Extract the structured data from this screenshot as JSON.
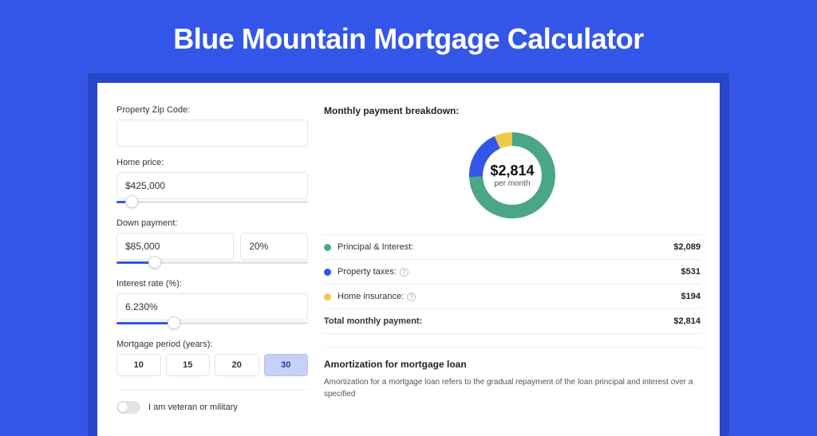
{
  "page": {
    "title": "Blue Mountain Mortgage Calculator"
  },
  "form": {
    "zip": {
      "label": "Property Zip Code:",
      "value": ""
    },
    "price": {
      "label": "Home price:",
      "value": "$425,000",
      "slider_pct": 8
    },
    "down": {
      "label": "Down payment:",
      "value": "$85,000",
      "pct": "20%",
      "slider_pct": 20
    },
    "rate": {
      "label": "Interest rate (%):",
      "value": "6.230%",
      "slider_pct": 30
    },
    "period": {
      "label": "Mortgage period (years):",
      "options": [
        "10",
        "15",
        "20",
        "30"
      ],
      "selected": "30"
    },
    "veteran": {
      "label": "I am veteran or military",
      "on": false
    }
  },
  "breakdown": {
    "title": "Monthly payment breakdown:",
    "center": {
      "amount": "$2,814",
      "sub": "per month"
    },
    "items": [
      {
        "label": "Principal & Interest:",
        "value": "$2,089",
        "color": "#49a687",
        "info": false
      },
      {
        "label": "Property taxes:",
        "value": "$531",
        "color": "#3456e8",
        "info": true
      },
      {
        "label": "Home insurance:",
        "value": "$194",
        "color": "#efc94c",
        "info": true
      }
    ],
    "total": {
      "label": "Total monthly payment:",
      "value": "$2,814"
    }
  },
  "chart_data": {
    "type": "pie",
    "title": "Monthly payment breakdown",
    "series": [
      {
        "name": "Principal & Interest",
        "value": 2089,
        "color": "#49a687"
      },
      {
        "name": "Property taxes",
        "value": 531,
        "color": "#3456e8"
      },
      {
        "name": "Home insurance",
        "value": 194,
        "color": "#efc94c"
      }
    ],
    "total": 2814,
    "center_label": "$2,814 per month"
  },
  "amortization": {
    "title": "Amortization for mortgage loan",
    "body": "Amortization for a mortgage loan refers to the gradual repayment of the loan principal and interest over a specified"
  }
}
